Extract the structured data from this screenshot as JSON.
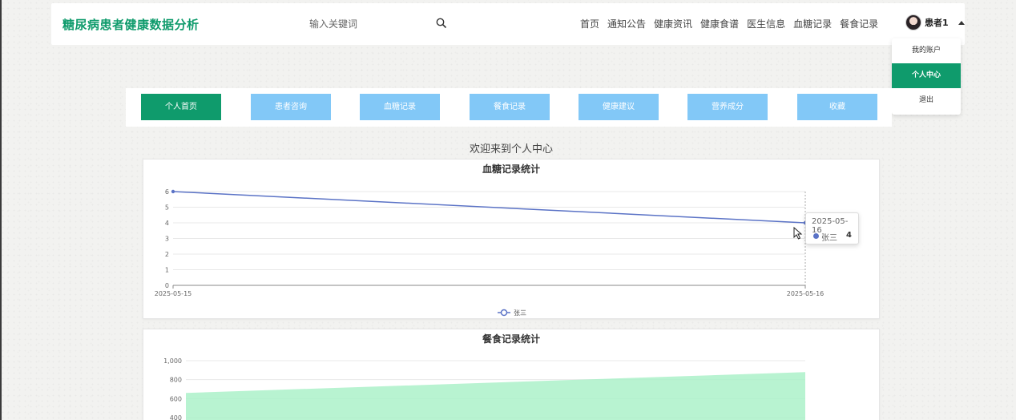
{
  "header": {
    "brand": "糖尿病患者健康数据分析",
    "search_placeholder": "输入关键词",
    "nav": [
      "首页",
      "通知公告",
      "健康资讯",
      "健康食谱",
      "医生信息",
      "血糖记录",
      "餐食记录"
    ],
    "user_name": "患者1"
  },
  "dropdown": {
    "items": [
      "我的账户",
      "个人中心",
      "退出"
    ],
    "active_index": 1
  },
  "tabs": {
    "items": [
      "个人首页",
      "患者咨询",
      "血糖记录",
      "餐食记录",
      "健康建议",
      "营养成分",
      "收藏"
    ],
    "active_index": 0
  },
  "welcome": "欢迎来到个人中心",
  "tooltip": {
    "date": "2025-05-16",
    "name": "张三",
    "value": "4"
  },
  "colors": {
    "brand": "#0f9b6c",
    "tab": "#82c8f7",
    "line": "#5b73c6",
    "area": "#a6f0c6"
  },
  "chart_data": [
    {
      "type": "line",
      "title": "血糖记录统计",
      "x": [
        "2025-05-15",
        "2025-05-16"
      ],
      "series": [
        {
          "name": "张三",
          "values": [
            6,
            4
          ]
        }
      ],
      "ylim": [
        0,
        6
      ],
      "yticks": [
        0,
        1,
        2,
        3,
        4,
        5,
        6
      ],
      "legend": "bottom-center",
      "grid": true
    },
    {
      "type": "area",
      "title": "餐食记录统计",
      "series": [
        {
          "values": [
            660,
            880
          ]
        }
      ],
      "ylim": [
        400,
        1000
      ],
      "yticks": [
        "400",
        "600",
        "800",
        "1,000"
      ],
      "grid": true
    }
  ]
}
